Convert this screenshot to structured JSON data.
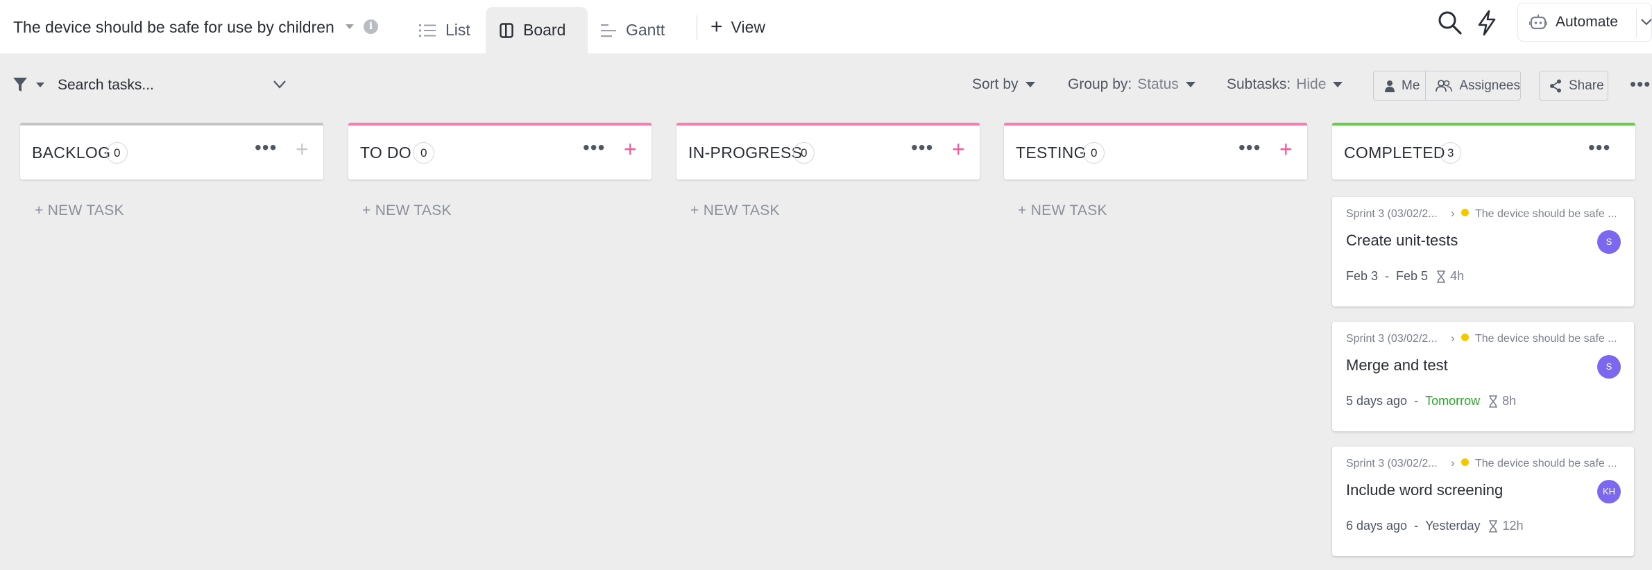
{
  "header": {
    "title": "The device should be safe for use by children",
    "tabs": [
      {
        "label": "List",
        "icon": "list-icon"
      },
      {
        "label": "Board",
        "icon": "board-icon",
        "active": true
      },
      {
        "label": "Gantt",
        "icon": "gantt-icon"
      }
    ],
    "add_view_label": "View",
    "automate_label": "Automate"
  },
  "toolbar": {
    "search_placeholder": "Search tasks...",
    "sort_label": "Sort by",
    "group_label": "Group by:",
    "group_value": "Status",
    "subtasks_label": "Subtasks:",
    "subtasks_value": "Hide",
    "me_label": "Me",
    "assignees_label": "Assignees",
    "share_label": "Share"
  },
  "columns": [
    {
      "name": "BACKLOG",
      "count": "0",
      "color": "#c4c4c4",
      "new_task": "+ NEW TASK"
    },
    {
      "name": "TO DO",
      "count": "0",
      "color": "#f47fae",
      "new_task": "+ NEW TASK"
    },
    {
      "name": "IN-PROGRESS",
      "count": "0",
      "color": "#f47fae",
      "new_task": "+ NEW TASK"
    },
    {
      "name": "TESTING",
      "count": "0",
      "color": "#f47fae",
      "new_task": "+ NEW TASK"
    },
    {
      "name": "COMPLETED",
      "count": "3",
      "color": "#6bc950"
    }
  ],
  "cards": [
    {
      "sprint": "Sprint 3 (03/02/2...",
      "parent": "The device should be safe ...",
      "name": "Create unit-tests",
      "avatar": "S",
      "start": "Feb 3",
      "due": "Feb 5",
      "estimate": "4h"
    },
    {
      "sprint": "Sprint 3 (03/02/2...",
      "parent": "The device should be safe ...",
      "name": "Merge and test",
      "avatar": "S",
      "start": "5 days ago",
      "due": "Tomorrow",
      "estimate": "8h"
    },
    {
      "sprint": "Sprint 3 (03/02/2...",
      "parent": "The device should be safe ...",
      "name": "Include word screening",
      "avatar": "KH",
      "start": "6 days ago",
      "due": "Yesterday",
      "estimate": "12h"
    }
  ],
  "colors": {
    "accent_pink": "#f05c9b",
    "completed_green": "#6bc950",
    "avatar_purple": "#7b68ee",
    "due_green": "#2ea52c",
    "dot_yellow": "#f2c800"
  }
}
